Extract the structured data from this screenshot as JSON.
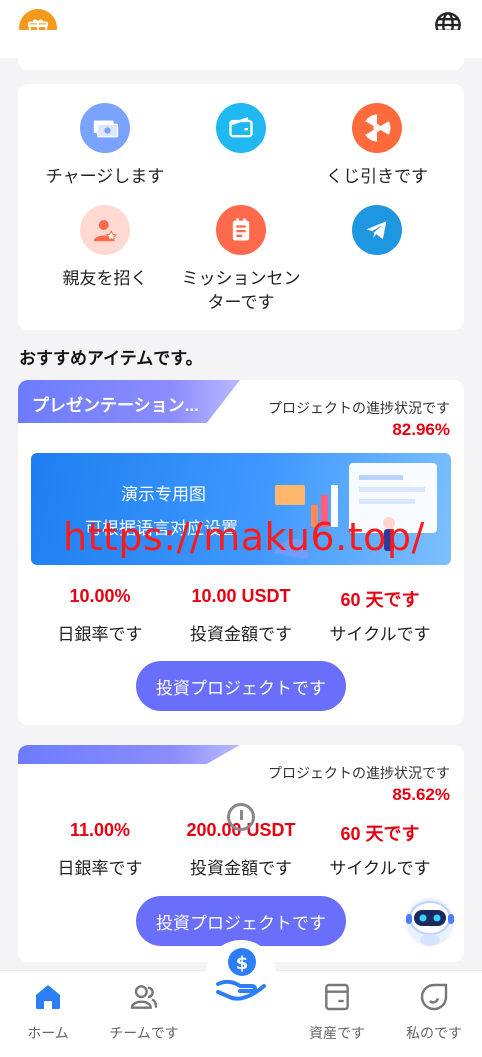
{
  "header": {
    "gift_icon": "gift-icon",
    "language_icon": "globe-icon"
  },
  "quick_actions": [
    {
      "label": "チャージします",
      "icon": "money-icon",
      "color": "#7aa2ff"
    },
    {
      "label": "",
      "icon": "wallet-icon",
      "color": "#1fb8f0"
    },
    {
      "label": "くじ引きです",
      "icon": "wheel-icon",
      "color": "#ff6a3d"
    },
    {
      "label": "親友を招く",
      "icon": "invite-user-icon",
      "color": "#ffd9d2"
    },
    {
      "label": "ミッションセンターです",
      "label_line1": "ミッションセン",
      "label_line2": "ターです",
      "icon": "task-list-icon",
      "color": "#ff6a4d"
    },
    {
      "label": "",
      "icon": "telegram-icon",
      "color": "#1f96e0"
    }
  ],
  "section_title": "おすすめアイテムです。",
  "items": [
    {
      "ribbon_title": "プレゼンテーション...",
      "progress_label": "プロジェクトの進捗状況です",
      "progress_value": "82.96%",
      "progress_fraction": 0.8296,
      "banner_line1": "演示专用图",
      "banner_line2": "可根据语言对应设置",
      "daily_rate": "10.00%",
      "amount": "10.00 USDT",
      "cycle": "60 天です",
      "daily_rate_label": "日銀率です",
      "amount_label": "投資金額です",
      "cycle_label": "サイクルです",
      "button": "投資プロジェクトです"
    },
    {
      "ribbon_title": "",
      "progress_label": "プロジェクトの進捗状況です",
      "progress_value": "85.62%",
      "progress_fraction": 0.8562,
      "daily_rate": "11.00%",
      "amount": "200.00 USDT",
      "cycle": "60 天です",
      "daily_rate_label": "日銀率です",
      "amount_label": "投資金額です",
      "cycle_label": "サイクルです",
      "button": "投資プロジェクトです"
    }
  ],
  "watermark": "https://maku6.top/",
  "tabbar": {
    "home": "ホーム",
    "team": "チームです",
    "invest_icon": "dollar-hand-icon",
    "assets": "資産です",
    "mine": "私のです",
    "active_color": "#2d7df6"
  }
}
